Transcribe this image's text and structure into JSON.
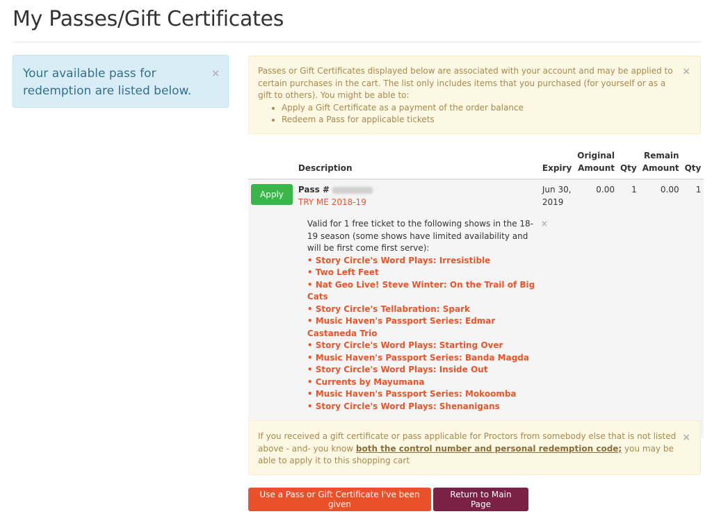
{
  "page": {
    "title": "My Passes/Gift Certificates"
  },
  "info_alert": {
    "text": "Your available pass for redemption are listed below.",
    "close": "×"
  },
  "warning_alert": {
    "intro": "Passes or Gift Certificates displayed below are associated with your account and may be applied to certain purchases in the cart. The list only includes items that you purchased (for yourself or as a gift to others). You might be able to:",
    "items": [
      "Apply a Gift Certificate as a payment of the order balance",
      "Redeem a Pass for applicable tickets"
    ],
    "close": "×"
  },
  "table": {
    "headers": {
      "description": "Description",
      "expiry": "Expiry",
      "original_amount": "Original Amount",
      "qty": "Qty",
      "remain_amount": "Remain Amount",
      "remain_qty": "Qty"
    },
    "row": {
      "apply_label": "Apply",
      "pass_label": "Pass #",
      "pass_name": "TRY ME 2018-19",
      "expiry": "Jun 30, 2019",
      "original_amount": "0.00",
      "qty": "1",
      "remain_amount": "0.00",
      "remain_qty": "1",
      "description_close": "×",
      "description_text": "Valid for 1 free ticket to the following shows in the 18-19 season (some shows have limited availability and will be first come first serve):",
      "shows": [
        "• Story Circle's Word Plays: Irresistible",
        "• Two Left Feet",
        "• Nat Geo Live! Steve Winter: On the Trail of Big Cats",
        "• Story Circle's Tellabration: Spark",
        "• Music Haven's Passport Series: Edmar Castaneda Trio",
        "• Story Circle's Word Plays: Starting Over",
        "• Music Haven's Passport Series: Banda Magda",
        "• Story Circle's Word Plays: Inside Out",
        "• Currents by Mayumana",
        "• Music Haven's Passport Series: Mokoomba",
        "• Story Circle's Word Plays: Shenanigans"
      ]
    }
  },
  "bottom_alert": {
    "text_before": "If you received a gift certificate or pass applicable for Proctors from somebody else that is not listed above - and- you know ",
    "link_text": "both the control number and personal redemption code;",
    "text_after": " you may be able to apply it to this shopping cart",
    "close": "×"
  },
  "buttons": {
    "use_pass": "Use a Pass or Gift Certificate I've been given",
    "return_main": "Return to Main Page"
  },
  "colors": {
    "apply": "#39b54a",
    "orange": "#e8512a",
    "purple": "#7b2148",
    "link_red": "#e8552a"
  }
}
